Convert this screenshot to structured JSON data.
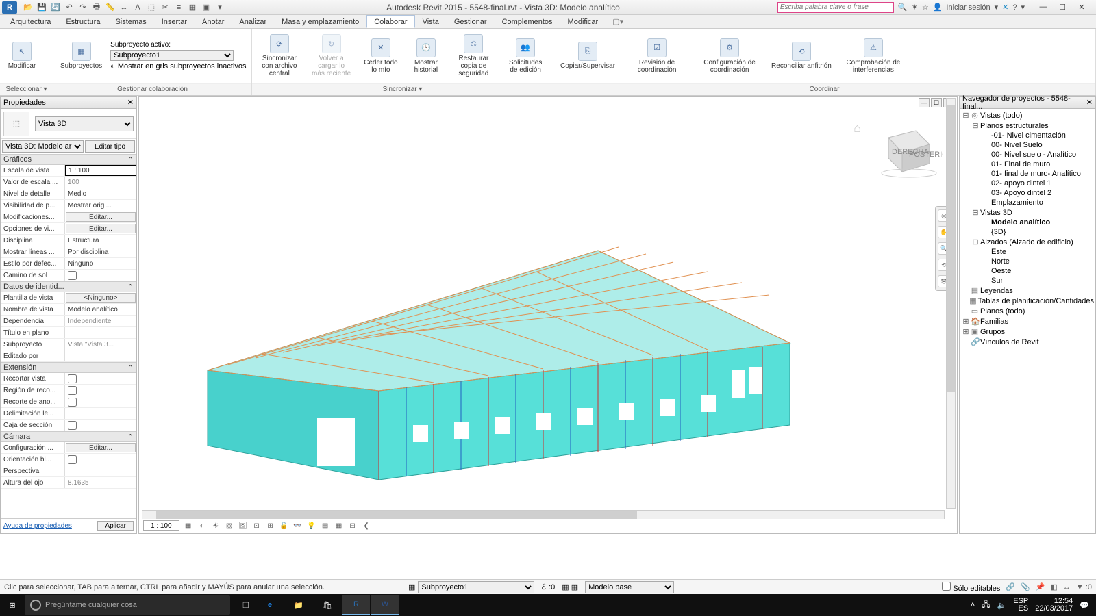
{
  "titlebar": {
    "app_logo": "R",
    "title": "Autodesk Revit 2015 -     5548-final.rvt - Vista 3D: Modelo analítico",
    "search_placeholder": "Escriba palabra clave o frase",
    "sign_in": "Iniciar sesión",
    "help": "?"
  },
  "menubar": {
    "tabs": [
      "Arquitectura",
      "Estructura",
      "Sistemas",
      "Insertar",
      "Anotar",
      "Analizar",
      "Masa y emplazamiento",
      "Colaborar",
      "Vista",
      "Gestionar",
      "Complementos",
      "Modificar"
    ],
    "active": "Colaborar"
  },
  "ribbon": {
    "select_panel": {
      "modify": "Modificar",
      "label": "Seleccionar ▾"
    },
    "collab_panel": {
      "subprojects": "Subproyectos",
      "active_label": "Subproyecto activo:",
      "active_value": "Subproyecto1",
      "gray_inactive": "Mostrar en gris subproyectos inactivos",
      "label": "Gestionar colaboración"
    },
    "sync_panel": {
      "sync_central": "Sincronizar con archivo central",
      "reload": "Volver a cargar lo más reciente",
      "relinquish": "Ceder todo lo mío",
      "history": "Mostrar historial",
      "restore": "Restaurar copia de seguridad",
      "edit_requests": "Solicitudes de edición",
      "label": "Sincronizar ▾"
    },
    "coord_panel": {
      "copy_monitor": "Copiar/Supervisar",
      "coord_review": "Revisión de coordinación",
      "coord_settings": "Configuración de coordinación",
      "reconcile": "Reconciliar anfitrión",
      "interference": "Comprobación de interferencias",
      "label": "Coordinar"
    }
  },
  "properties": {
    "header": "Propiedades",
    "type_name": "Vista 3D",
    "instance_selector": "Vista 3D: Modelo ar",
    "edit_type": "Editar tipo",
    "groups": {
      "graficos": "Gráficos",
      "identidad": "Datos de identid...",
      "extension": "Extensión",
      "camara": "Cámara"
    },
    "rows": {
      "escala_vista_k": "Escala de vista",
      "escala_vista_v": "1 : 100",
      "valor_escala_k": "Valor de escala ...",
      "valor_escala_v": "100",
      "nivel_detalle_k": "Nivel de detalle",
      "nivel_detalle_v": "Medio",
      "visibilidad_k": "Visibilidad de p...",
      "visibilidad_v": "Mostrar origi...",
      "modificaciones_k": "Modificaciones...",
      "editar_btn": "Editar...",
      "opciones_vi_k": "Opciones de vi...",
      "disciplina_k": "Disciplina",
      "disciplina_v": "Estructura",
      "mostrar_lineas_k": "Mostrar líneas ...",
      "mostrar_lineas_v": "Por disciplina",
      "estilo_defecto_k": "Estilo por defec...",
      "estilo_defecto_v": "Ninguno",
      "camino_sol_k": "Camino de sol",
      "plantilla_k": "Plantilla de vista",
      "plantilla_v": "<Ninguno>",
      "nombre_vista_k": "Nombre de vista",
      "nombre_vista_v": "Modelo analítico",
      "dependencia_k": "Dependencia",
      "dependencia_v": "Independiente",
      "titulo_plano_k": "Título en plano",
      "subproyecto_k": "Subproyecto",
      "subproyecto_v": "Vista \"Vista 3...",
      "editado_por_k": "Editado por",
      "recortar_vista_k": "Recortar vista",
      "region_reco_k": "Región de reco...",
      "recorte_ano_k": "Recorte de ano...",
      "delimitacion_k": "Delimitación le...",
      "caja_seccion_k": "Caja de sección",
      "configuracion_k": "Configuración ...",
      "orientacion_k": "Orientación bl...",
      "perspectiva_k": "Perspectiva",
      "altura_ojo_k": "Altura del ojo",
      "altura_ojo_v": "8.1635"
    },
    "help_link": "Ayuda de propiedades",
    "apply": "Aplicar"
  },
  "canvas": {
    "scale": "1 : 100",
    "cube_face1": "DERECHA",
    "cube_face2": "POSTERIOR"
  },
  "browser": {
    "header": "Navegador de proyectos - 5548-final...",
    "vistas_todo": "Vistas (todo)",
    "planos_estructurales": "Planos estructurales",
    "items_planos": [
      "-01- Nivel cimentación",
      "00- Nivel Suelo",
      "00- Nivel suelo - Analítico",
      "01- Final de muro",
      "01- final de muro- Analítico",
      "02- apoyo dintel 1",
      "03- Apoyo dintel 2",
      "Emplazamiento"
    ],
    "vistas_3d": "Vistas 3D",
    "modelo_analitico": "Modelo analítico",
    "tres_d": "{3D}",
    "alzados": "Alzados (Alzado de edificio)",
    "alzados_items": [
      "Este",
      "Norte",
      "Oeste",
      "Sur"
    ],
    "leyendas": "Leyendas",
    "tablas": "Tablas de planificación/Cantidades",
    "planos_todo": "Planos (todo)",
    "familias": "Familias",
    "grupos": "Grupos",
    "vinculos": "Vínculos de Revit"
  },
  "statusbar": {
    "hint": "Clic para seleccionar, TAB para alternar, CTRL para añadir y MAYÚS para anular una selección.",
    "workset": "Subproyecto1",
    "exclude": ":0",
    "design_option": "Modelo base",
    "editable_only": "Sólo editables"
  },
  "taskbar": {
    "search_placeholder": "Pregúntame cualquier cosa",
    "lang1": "ESP",
    "lang2": "ES",
    "time": "12:54",
    "date": "22/03/2017"
  }
}
